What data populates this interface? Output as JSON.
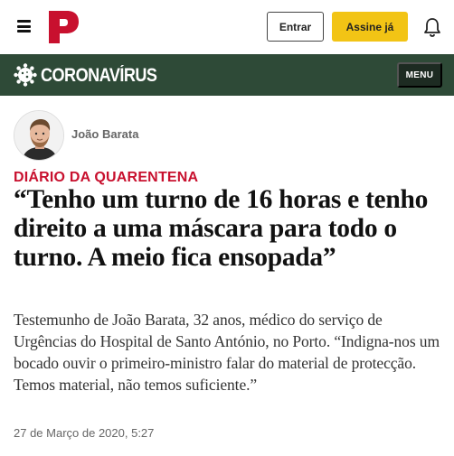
{
  "header": {
    "login_label": "Entrar",
    "subscribe_label": "Assine já",
    "menu_icon": "hamburger-icon",
    "notification_icon": "bell-icon",
    "brand_color": "#c8102e",
    "subscribe_color": "#f2c415"
  },
  "section": {
    "title": "CORONAVÍRUS",
    "icon": "virus-icon",
    "menu_label": "MENU",
    "bar_color": "#2e4a37"
  },
  "author": {
    "name": "João Barata"
  },
  "article": {
    "kicker": "DIÁRIO DA QUARENTENA",
    "headline": "“Tenho um turno de 16 horas e tenho direito a uma máscara para todo o turno. A meio fica ensopada”",
    "summary": "Testemunho de João Barata, 32 anos, médico do serviço de Urgências do Hospital de Santo António, no Porto. “Indigna-nos um bocado ouvir o primeiro-ministro falar do material de protecção. Temos material, não temos suficiente.”",
    "date": "27 de Março de 2020, 5:27"
  }
}
